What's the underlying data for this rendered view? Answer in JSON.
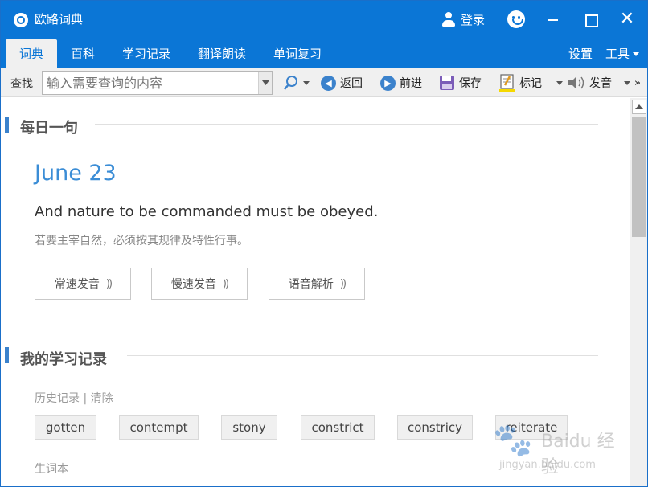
{
  "app": {
    "title": "欧路词典",
    "login_label": "登录",
    "close_glyph": "✕"
  },
  "nav": {
    "tabs": [
      {
        "label": "词典",
        "active": true
      },
      {
        "label": "百科",
        "active": false
      },
      {
        "label": "学习记录",
        "active": false
      },
      {
        "label": "翻译朗读",
        "active": false
      },
      {
        "label": "单词复习",
        "active": false
      }
    ],
    "settings_label": "设置",
    "tools_label": "工具"
  },
  "toolbar": {
    "find_label": "查找",
    "search_placeholder": "输入需要查询的内容",
    "search_value": "",
    "back_label": "返回",
    "forward_label": "前进",
    "save_label": "保存",
    "mark_label": "标记",
    "speak_label": "发音",
    "more_glyph": "»"
  },
  "daily": {
    "section_title": "每日一句",
    "date": "June 23",
    "sentence": "And nature to be commanded must be obeyed.",
    "translation": "若要主宰自然，必须按其规律及特性行事。",
    "buttons": [
      "常速发音",
      "慢速发音",
      "语音解析"
    ],
    "sound_glyph": "))"
  },
  "records": {
    "section_title": "我的学习记录",
    "history_label": "历史记录",
    "separator": " | ",
    "clear_label": "清除",
    "history_words": [
      "gotten",
      "contempt",
      "stony",
      "constrict",
      "constricy",
      "reiterate"
    ],
    "vocab_label": "生词本"
  },
  "watermark": {
    "brand": "Baidu 经验",
    "url": "jingyan.baidu.com"
  },
  "colors": {
    "titlebar": "#0b76d6",
    "accent": "#3b8dd6",
    "section_bar": "#3b82cc"
  },
  "icons": [
    "app-logo-icon",
    "user-icon",
    "smiley-icon",
    "minimize-icon",
    "maximize-icon",
    "close-icon",
    "search-icon",
    "back-arrow-icon",
    "forward-arrow-icon",
    "save-disk-icon",
    "mark-note-icon",
    "speaker-icon",
    "sound-wave-icon"
  ]
}
